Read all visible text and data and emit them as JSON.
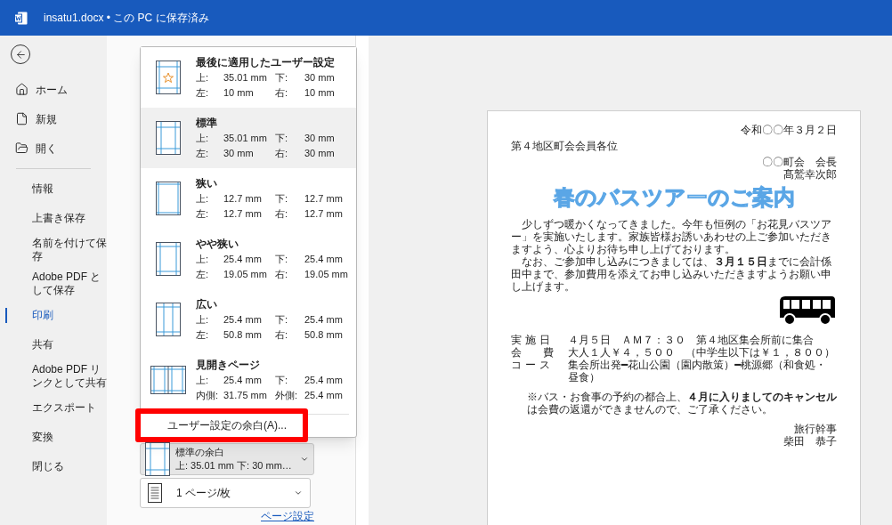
{
  "title_bar": {
    "title": "insatu1.docx • この PC に保存済み"
  },
  "sidebar": {
    "top_items": [
      {
        "label": "ホーム",
        "kind": "home"
      },
      {
        "label": "新規",
        "kind": "new"
      },
      {
        "label": "開く",
        "kind": "open"
      }
    ],
    "items": [
      {
        "label": "情報",
        "selected": false
      },
      {
        "label": "上書き保存",
        "selected": false
      },
      {
        "label": "名前を付けて保存",
        "selected": false
      },
      {
        "label": "Adobe PDF として保存",
        "selected": false
      },
      {
        "label": "印刷",
        "selected": true
      },
      {
        "label": "共有",
        "selected": false
      },
      {
        "label": "Adobe PDF リンクとして共有",
        "selected": false
      },
      {
        "label": "エクスポート",
        "selected": false
      },
      {
        "label": "変換",
        "selected": false
      },
      {
        "label": "閉じる",
        "selected": false
      }
    ]
  },
  "margins_menu": {
    "options": [
      {
        "name": "最後に適用したユーザー設定",
        "kind": "custom",
        "selected": false,
        "rows": [
          [
            "上:",
            "35.01 mm",
            "下:",
            "30 mm"
          ],
          [
            "左:",
            "10 mm",
            "右:",
            "10 mm"
          ]
        ]
      },
      {
        "name": "標準",
        "kind": "normal",
        "selected": true,
        "rows": [
          [
            "上:",
            "35.01 mm",
            "下:",
            "30 mm"
          ],
          [
            "左:",
            "30 mm",
            "右:",
            "30 mm"
          ]
        ]
      },
      {
        "name": "狭い",
        "kind": "narrow",
        "selected": false,
        "rows": [
          [
            "上:",
            "12.7 mm",
            "下:",
            "12.7 mm"
          ],
          [
            "左:",
            "12.7 mm",
            "右:",
            "12.7 mm"
          ]
        ]
      },
      {
        "name": "やや狭い",
        "kind": "moderate",
        "selected": false,
        "rows": [
          [
            "上:",
            "25.4 mm",
            "下:",
            "25.4 mm"
          ],
          [
            "左:",
            "19.05 mm",
            "右:",
            "19.05 mm"
          ]
        ]
      },
      {
        "name": "広い",
        "kind": "wide",
        "selected": false,
        "rows": [
          [
            "上:",
            "25.4 mm",
            "下:",
            "25.4 mm"
          ],
          [
            "左:",
            "50.8 mm",
            "右:",
            "50.8 mm"
          ]
        ]
      },
      {
        "name": "見開きページ",
        "kind": "mirrored",
        "selected": false,
        "rows": [
          [
            "上:",
            "25.4 mm",
            "下:",
            "25.4 mm"
          ],
          [
            "内側:",
            "31.75 mm",
            "外側:",
            "25.4 mm"
          ]
        ]
      }
    ],
    "custom_margins": "ユーザー設定の余白(A)..."
  },
  "settings": {
    "margins_selector": {
      "title": "標準の余白",
      "detail": "上: 35.01 mm 下: 30 mm…"
    },
    "pages_selector": {
      "label": "1 ページ/枚"
    },
    "page_setup_link": "ページ設定"
  },
  "document": {
    "date": "令和〇〇年３月２日",
    "addressee": "第４地区町会会員各位",
    "sender": [
      "〇〇町会　会長",
      "髙鷲幸次郎"
    ],
    "title": "春のバスツアーのご案内",
    "paragraphs": [
      "少しずつ暖かくなってきました。今年も恒例の「お花見バスツアー」を実施いたします。家族皆様お誘いあわせの上ご参加いただきますよう、心よりお待ち申し上げております。",
      "なお、ご参加申し込みにつきましては、**３月１５日**までに会計係田中まで、参加費用を添えてお申し込みいただきますようお願い申し上げます。"
    ],
    "details": [
      {
        "label": "実 施 日",
        "value": "４月５日　ＡＭ７：３０　第４地区集会所前に集合"
      },
      {
        "label": "会　　費",
        "value": "大人１人￥４，５００　（中学生以下は￥１，８００）"
      },
      {
        "label": "コ ー ス",
        "value": "集会所出発━花山公園（園内散策）━桃源郷（和食処・昼食）"
      }
    ],
    "note": "※バス・お食事の予約の都合上、**４月に入りましてのキャンセル**は会費の返還ができませんので、ご了承ください。",
    "signature": [
      "旅行幹事",
      "柴田　恭子"
    ]
  }
}
